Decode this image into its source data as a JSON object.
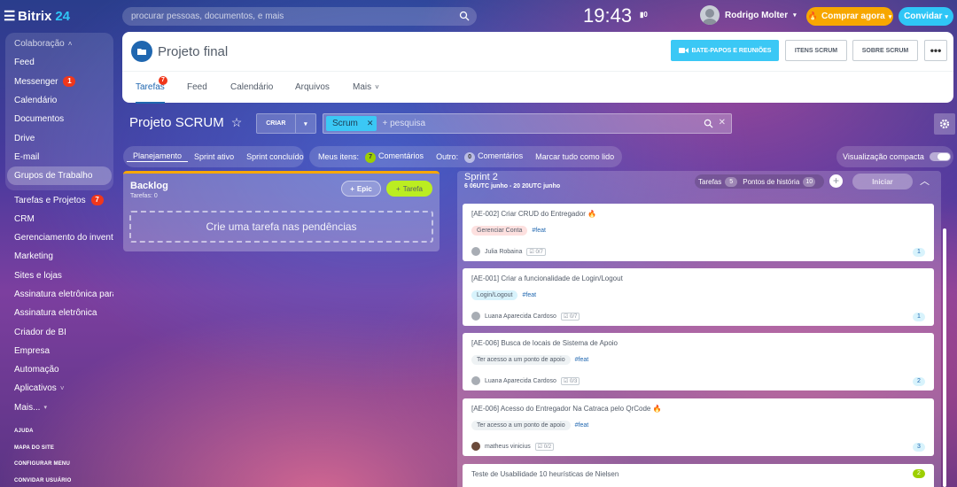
{
  "topbar": {
    "logo_text": "Bitrix",
    "logo_num": "24",
    "search_placeholder": "procurar pessoas, documentos, e mais",
    "clock": "19:43",
    "clock_badge": "0",
    "user_name": "Rodrigo Molter",
    "buy_label": "Comprar agora",
    "invite_label": "Convidar"
  },
  "sidebar": {
    "group_label": "Colaboração",
    "items": [
      {
        "label": "Feed"
      },
      {
        "label": "Messenger",
        "count": "1"
      },
      {
        "label": "Calendário"
      },
      {
        "label": "Documentos"
      },
      {
        "label": "Drive"
      },
      {
        "label": "E-mail"
      },
      {
        "label": "Grupos de Trabalho"
      },
      {
        "label": "Tarefas e Projetos",
        "count": "7"
      },
      {
        "label": "CRM"
      },
      {
        "label": "Gerenciamento do invent..."
      },
      {
        "label": "Marketing"
      },
      {
        "label": "Sites e lojas"
      },
      {
        "label": "Assinatura eletrônica para..."
      },
      {
        "label": "Assinatura eletrônica"
      },
      {
        "label": "Criador de BI"
      },
      {
        "label": "Empresa"
      },
      {
        "label": "Automação"
      },
      {
        "label": "Aplicativos"
      },
      {
        "label": "Mais..."
      }
    ],
    "footer": [
      "AJUDA",
      "MAPA DO SITE",
      "CONFIGURAR MENU",
      "CONVIDAR USUÁRIO"
    ]
  },
  "project": {
    "title": "Projeto final",
    "btn_chats": "BATE-PAPOS E REUNIÕES",
    "btn_items": "ITENS SCRUM",
    "btn_about": "SOBRE SCRUM",
    "tabs": [
      {
        "label": "Tarefas",
        "count": "7"
      },
      {
        "label": "Feed"
      },
      {
        "label": "Calendário"
      },
      {
        "label": "Arquivos"
      },
      {
        "label": "Mais"
      }
    ]
  },
  "scrum": {
    "title": "Projeto SCRUM",
    "criar": "CRIAR",
    "filter_chip": "Scrum",
    "filter_placeholder": "+ pesquisa"
  },
  "viewbar": {
    "plan": "Planejamento",
    "active": "Sprint ativo",
    "done": "Sprint concluído"
  },
  "itemsbar": {
    "my_items": "Meus itens:",
    "my_count": "7",
    "comments": "Comentários",
    "other": "Outro:",
    "other_count": "0",
    "other_comments": "Comentários",
    "mark_read": "Marcar tudo como lido"
  },
  "compact": {
    "label": "Visualização compacta"
  },
  "backlog": {
    "title": "Backlog",
    "subtitle": "Tarefas: 0",
    "epic_label": "Epic",
    "task_label": "Tarefa",
    "drop_text": "Crie uma tarefa nas pendências"
  },
  "sprint": {
    "title": "Sprint 2",
    "dates": "6 06UTC junho - 20 20UTC junho",
    "tasks_label": "Tarefas",
    "tasks_count": "5",
    "points_label": "Pontos de história",
    "points_count": "10",
    "start_label": "Iniciar"
  },
  "tasks": [
    {
      "title": "[AE-002] Criar CRUD do Entregador",
      "tag": "Gerenciar Conta",
      "hash": "#feat",
      "person": "Julia Robaina",
      "checklist": "0/7",
      "points": "1"
    },
    {
      "title": "[AE-001] Criar a funcionalidade de Login/Logout",
      "tag": "Login/Logout",
      "hash": "#feat",
      "person": "Luana Aparecida Cardoso",
      "checklist": "0/7",
      "points": "1"
    },
    {
      "title": "[AE-006] Busca de locais de Sistema de Apoio",
      "tag": "Ter acesso a um ponto de apoio",
      "hash": "#feat",
      "person": "Luana Aparecida Cardoso",
      "checklist": "0/3",
      "points": "2"
    },
    {
      "title": "[AE-006] Acesso do Entregador Na Catraca pelo QrCode",
      "tag": "Ter acesso a um ponto de apoio",
      "hash": "#feat",
      "person": "matheus vinicius",
      "checklist": "0/2",
      "points": "3"
    },
    {
      "title": "Teste de Usabilidade 10 heurísticas de Nielsen",
      "points": "2"
    }
  ]
}
